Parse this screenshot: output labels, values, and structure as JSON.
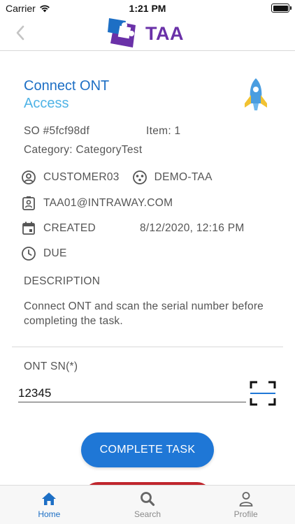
{
  "status_bar": {
    "carrier": "Carrier",
    "time": "1:21 PM"
  },
  "header": {
    "logo_text": "TAA",
    "back_icon": "chevron-left-icon"
  },
  "task": {
    "title": "Connect ONT",
    "subtitle": "Access",
    "icon": "rocket-icon",
    "so": "SO #5fcf98df",
    "item": "Item: 1",
    "category": "Category: CategoryTest",
    "customer": "CUSTOMER03",
    "group": "DEMO-TAA",
    "email": "TAA01@INTRAWAY.COM",
    "status": "CREATED",
    "created_date": "8/12/2020, 12:16 PM",
    "due": "DUE",
    "description_label": "DESCRIPTION",
    "description": "Connect ONT and scan the serial number before completing the task."
  },
  "form": {
    "ont_label": "ONT SN(*)",
    "ont_value": "12345"
  },
  "actions": {
    "complete_label": "COMPLETE TASK"
  },
  "tabs": [
    {
      "label": "Home",
      "icon": "home-icon",
      "active": true
    },
    {
      "label": "Search",
      "icon": "search-icon",
      "active": false
    },
    {
      "label": "Profile",
      "icon": "profile-icon",
      "active": false
    }
  ],
  "colors": {
    "primary": "#1f77d6",
    "title": "#1d6fc5",
    "subtitle": "#4fb3e6",
    "logo_purple": "#6a31a8",
    "danger": "#c0262d"
  }
}
